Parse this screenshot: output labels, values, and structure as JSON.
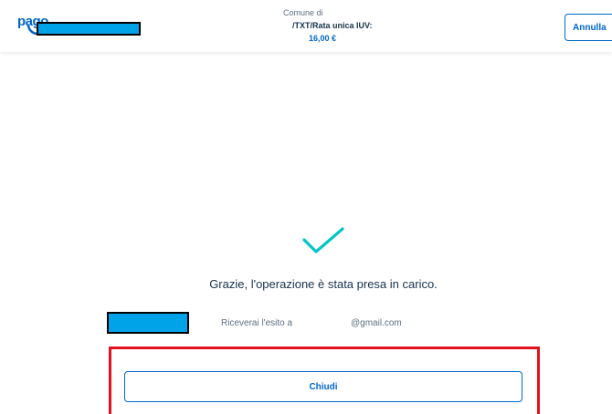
{
  "header": {
    "logo_text": "pago",
    "payment": {
      "line1": "Comune di",
      "line2": "/TXT/Rata unica IUV:",
      "amount": "16,00 €"
    },
    "cancel_label": "Annulla"
  },
  "result": {
    "message": "Grazie, l'operazione è stata presa in carico.",
    "outcome_label": "Riceverai l'esito a",
    "email_suffix": "@gmail.com",
    "close_label": "Chiudi"
  },
  "colors": {
    "primary": "#0066cc",
    "text": "#17324d",
    "muted": "#5c6f82",
    "success": "#00c5ca",
    "highlight": "#e3101f",
    "redaction": "#00a2e8"
  },
  "icons": {
    "success": "checkmark-icon"
  }
}
